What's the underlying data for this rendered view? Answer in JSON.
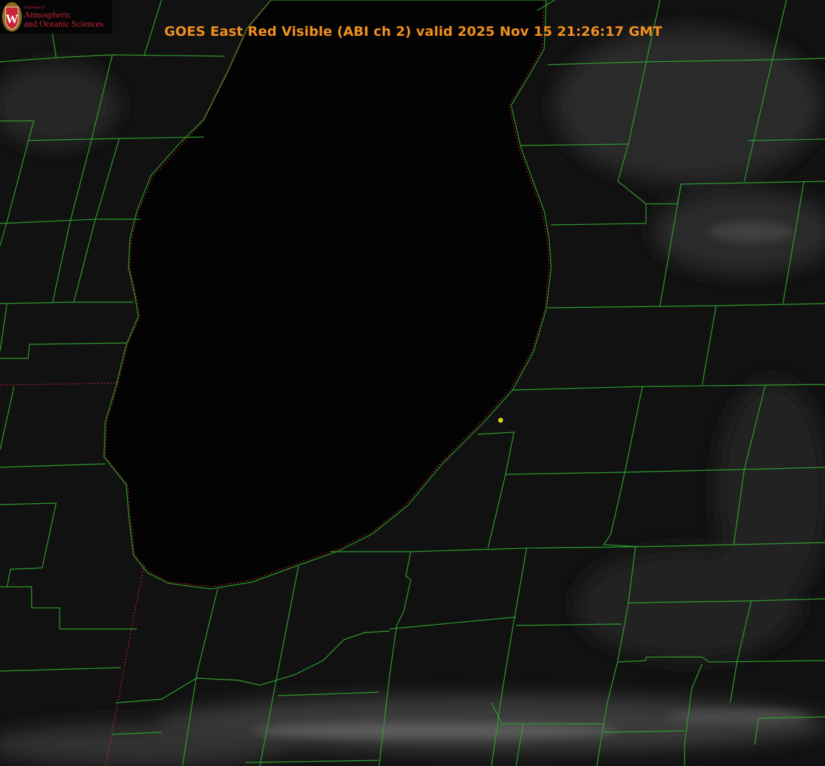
{
  "title": "GOES East Red Visible (ABI ch 2) valid 2025 Nov 15 21:26:17 GMT",
  "logo": {
    "department": "Department of",
    "line1": "Atmospheric",
    "line2": "and Oceanic Sciences",
    "crest_letter": "W"
  },
  "colors": {
    "title": "#f0901e",
    "county_lines": "#2fa02f",
    "state_line": "#e03030",
    "marker": "#d8d820",
    "logo_red": "#c8223a"
  }
}
